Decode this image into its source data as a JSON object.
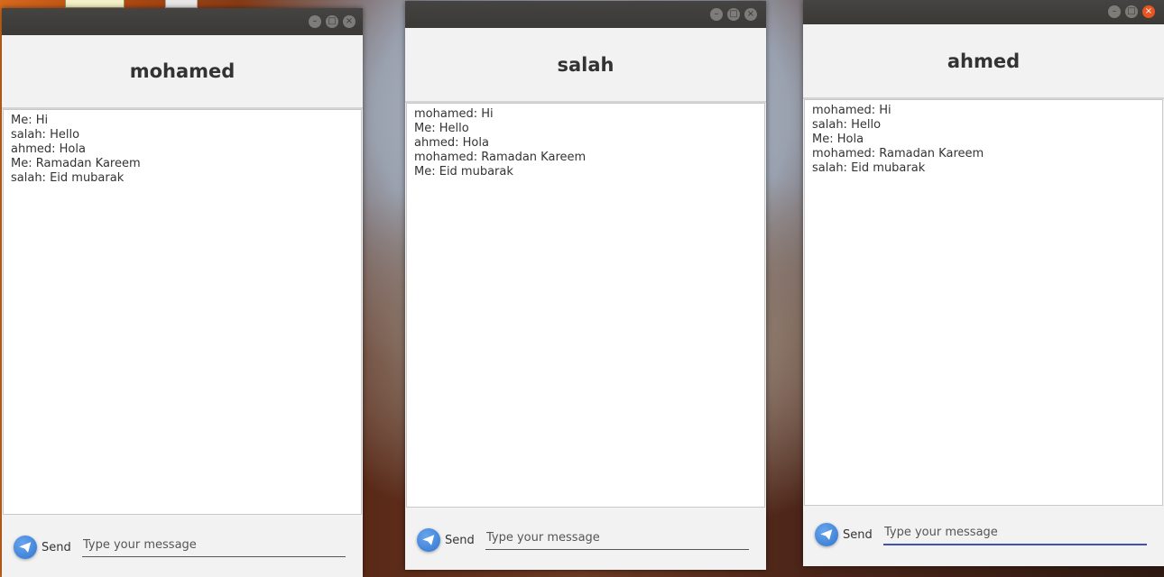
{
  "windows": [
    {
      "title": "mohamed",
      "messages": [
        "Me: Hi",
        "salah: Hello",
        "ahmed: Hola",
        "Me: Ramadan Kareem",
        "salah: Eid mubarak"
      ],
      "send_label": "Send",
      "input_placeholder": "Type your message",
      "input_value": ""
    },
    {
      "title": "salah",
      "messages": [
        "mohamed: Hi",
        "Me: Hello",
        "ahmed: Hola",
        "mohamed: Ramadan Kareem",
        "Me: Eid mubarak"
      ],
      "send_label": "Send",
      "input_placeholder": "Type your message",
      "input_value": ""
    },
    {
      "title": "ahmed",
      "messages": [
        "mohamed: Hi",
        "salah: Hello",
        "Me: Hola",
        "mohamed: Ramadan Kareem",
        "salah: Eid mubarak"
      ],
      "send_label": "Send",
      "input_placeholder": "Type your message",
      "input_value": ""
    }
  ],
  "colors": {
    "titlebar": "#3a3936",
    "close_active": "#e95420",
    "send_icon": "#2f74d0",
    "input_focus": "#3f51b5"
  }
}
